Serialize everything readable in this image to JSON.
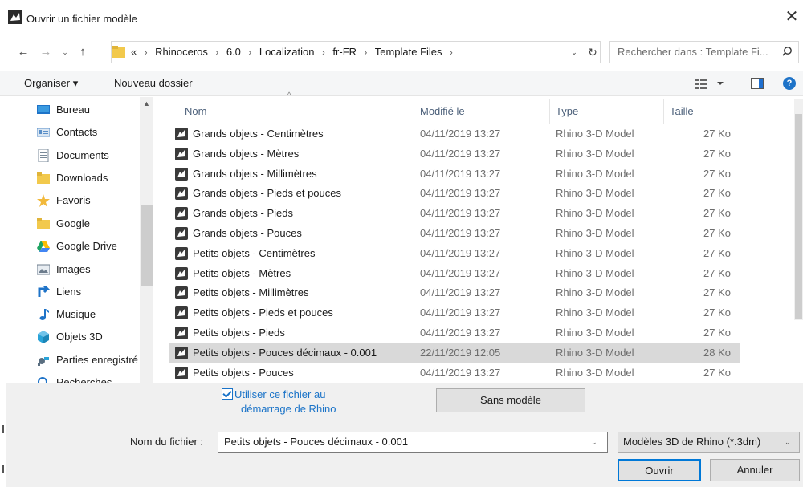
{
  "window": {
    "title": "Ouvrir un fichier modèle",
    "close_glyph": "✕"
  },
  "nav": {
    "back_glyph": "←",
    "forward_glyph": "→",
    "recent_glyph": "⌄",
    "up_glyph": "↑"
  },
  "address": {
    "overflow": "«",
    "crumbs": [
      "Rhinoceros",
      "6.0",
      "Localization",
      "fr-FR",
      "Template Files"
    ],
    "separator": "›",
    "dropdown_glyph": "⌄",
    "refresh_glyph": "↻"
  },
  "search": {
    "placeholder": "Rechercher dans : Template Fi...",
    "icon": "search-icon"
  },
  "toolbar": {
    "organize_label": "Organiser ▾",
    "new_folder_label": "Nouveau dossier",
    "help_glyph": "?"
  },
  "sidebar": {
    "items": [
      {
        "label": "Bureau",
        "icon": "desktop-icon",
        "color": "#1e73c8"
      },
      {
        "label": "Contacts",
        "icon": "contacts-icon",
        "color": "#5a8fc8"
      },
      {
        "label": "Documents",
        "icon": "documents-icon",
        "color": "#7a8a99"
      },
      {
        "label": "Downloads",
        "icon": "folder-icon",
        "color": "#f2c94c"
      },
      {
        "label": "Favoris",
        "icon": "star-icon",
        "color": "#f2b93b"
      },
      {
        "label": "Google",
        "icon": "folder-icon",
        "color": "#f2c94c"
      },
      {
        "label": "Google Drive",
        "icon": "google-drive-icon",
        "color": "#1fa463"
      },
      {
        "label": "Images",
        "icon": "images-icon",
        "color": "#6c7c8c"
      },
      {
        "label": "Liens",
        "icon": "link-icon",
        "color": "#1e73c8"
      },
      {
        "label": "Musique",
        "icon": "music-icon",
        "color": "#1e73c8"
      },
      {
        "label": "Objets 3D",
        "icon": "cube-icon",
        "color": "#29a3d8"
      },
      {
        "label": "Parties enregistré",
        "icon": "saved-games-icon",
        "color": "#5a6e80"
      },
      {
        "label": "Recherches",
        "icon": "search-folder-icon",
        "color": "#1e73c8"
      }
    ]
  },
  "columns": {
    "name": "Nom",
    "modified": "Modifié le",
    "type": "Type",
    "size": "Taille",
    "sort_glyph": "^"
  },
  "files": [
    {
      "name": "Grands objets - Centimètres",
      "modified": "04/11/2019 13:27",
      "type": "Rhino 3-D Model",
      "size": "27 Ko"
    },
    {
      "name": "Grands objets - Mètres",
      "modified": "04/11/2019 13:27",
      "type": "Rhino 3-D Model",
      "size": "27 Ko"
    },
    {
      "name": "Grands objets - Millimètres",
      "modified": "04/11/2019 13:27",
      "type": "Rhino 3-D Model",
      "size": "27 Ko"
    },
    {
      "name": "Grands objets - Pieds et pouces",
      "modified": "04/11/2019 13:27",
      "type": "Rhino 3-D Model",
      "size": "27 Ko"
    },
    {
      "name": "Grands objets - Pieds",
      "modified": "04/11/2019 13:27",
      "type": "Rhino 3-D Model",
      "size": "27 Ko"
    },
    {
      "name": "Grands objets - Pouces",
      "modified": "04/11/2019 13:27",
      "type": "Rhino 3-D Model",
      "size": "27 Ko"
    },
    {
      "name": "Petits objets - Centimètres",
      "modified": "04/11/2019 13:27",
      "type": "Rhino 3-D Model",
      "size": "27 Ko"
    },
    {
      "name": "Petits objets - Mètres",
      "modified": "04/11/2019 13:27",
      "type": "Rhino 3-D Model",
      "size": "27 Ko"
    },
    {
      "name": "Petits objets - Millimètres",
      "modified": "04/11/2019 13:27",
      "type": "Rhino 3-D Model",
      "size": "27 Ko"
    },
    {
      "name": "Petits objets - Pieds et pouces",
      "modified": "04/11/2019 13:27",
      "type": "Rhino 3-D Model",
      "size": "27 Ko"
    },
    {
      "name": "Petits objets - Pieds",
      "modified": "04/11/2019 13:27",
      "type": "Rhino 3-D Model",
      "size": "27 Ko"
    },
    {
      "name": "Petits objets - Pouces décimaux - 0.001",
      "modified": "22/11/2019 12:05",
      "type": "Rhino 3-D Model",
      "size": "28 Ko",
      "selected": true
    },
    {
      "name": "Petits objets - Pouces",
      "modified": "04/11/2019 13:27",
      "type": "Rhino 3-D Model",
      "size": "27 Ko"
    }
  ],
  "startup_option": {
    "label_line1": "Utiliser ce fichier au",
    "label_line2": "démarrage de Rhino",
    "checked": true
  },
  "buttons": {
    "no_template": "Sans modèle",
    "open": "Ouvrir",
    "cancel": "Annuler"
  },
  "filename": {
    "label": "Nom du fichier :",
    "value": "Petits objets - Pouces décimaux - 0.001",
    "dropdown_glyph": "⌄"
  },
  "file_type": {
    "value": "Modèles 3D de Rhino (*.3dm)",
    "dropdown_glyph": "⌄"
  },
  "colors": {
    "accent": "#0078d7",
    "selected_row": "#d9d9d9",
    "link_blue": "#1a73c8"
  }
}
